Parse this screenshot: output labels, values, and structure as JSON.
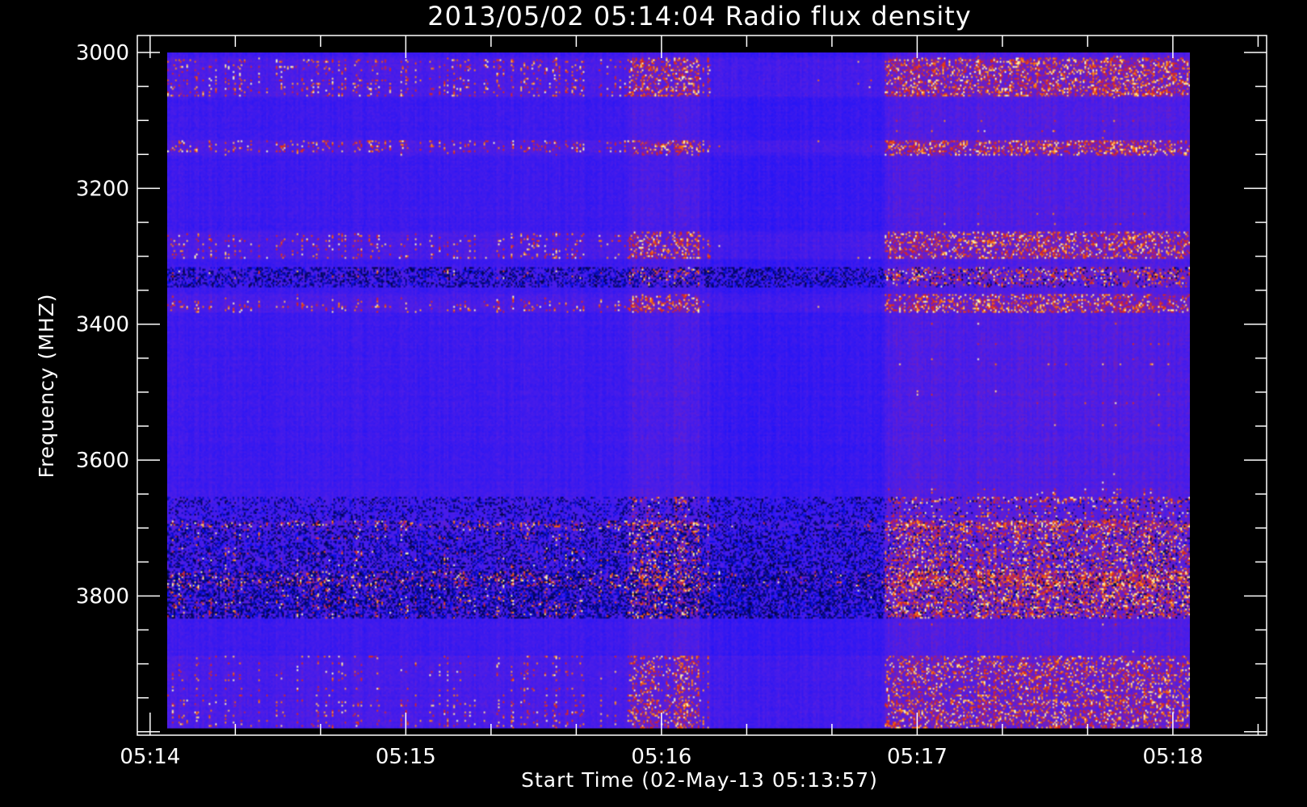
{
  "chart_data": {
    "type": "heatmap",
    "title": "2013/05/02 05:14:04 Radio flux density",
    "xlabel": "Start Time (02-May-13 05:13:57)",
    "ylabel": "Frequency (MHZ)",
    "x_ticks": [
      "05:14",
      "05:15",
      "05:16",
      "05:17",
      "05:18"
    ],
    "y_ticks": [
      "3000",
      "3200",
      "3400",
      "3600",
      "3800"
    ],
    "xlim": [
      "05:13:57",
      "05:18:22"
    ],
    "ylim": [
      2975,
      4005
    ],
    "data_extent": {
      "x": [
        "05:14:04",
        "05:18:04"
      ],
      "y": [
        3000,
        3995
      ]
    },
    "colormap": [
      "#000000",
      "#1010ff",
      "#8020c0",
      "#d02010",
      "#ff8000",
      "#ffffc0"
    ],
    "background": "#000000",
    "axis_color": "#ffffff"
  }
}
